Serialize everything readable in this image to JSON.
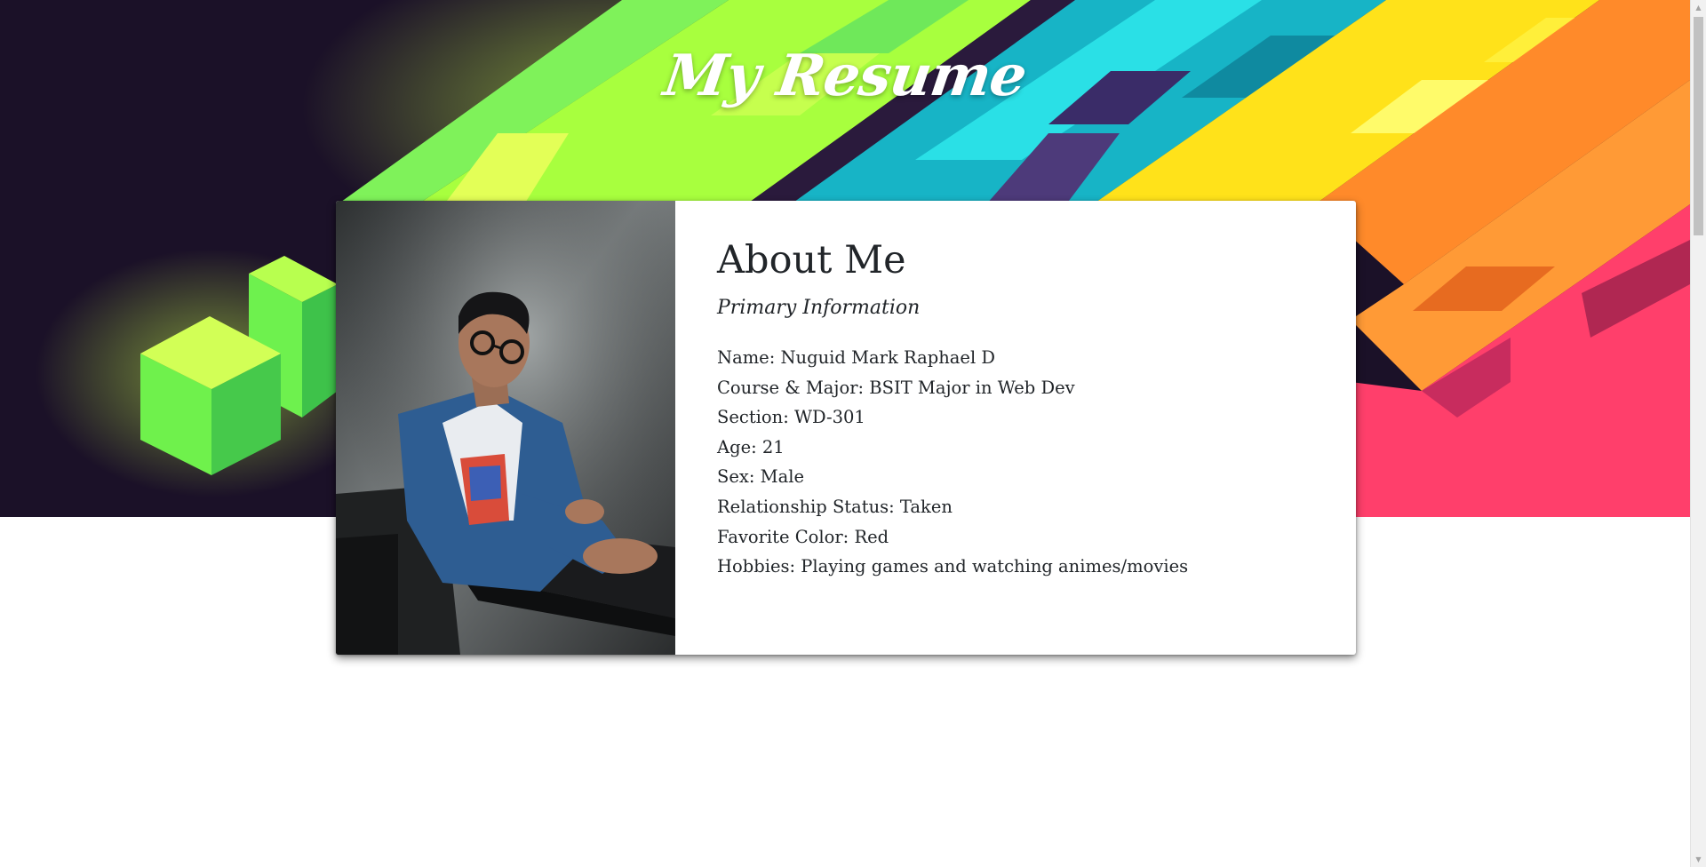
{
  "header": {
    "title": "My Resume"
  },
  "about": {
    "heading": "About Me",
    "subheading": "Primary Information",
    "photo_alt": "profile-photo",
    "items": [
      "Name: Nuguid Mark Raphael D",
      "Course & Major: BSIT Major in Web Dev",
      "Section: WD-301",
      "Age: 21",
      "Sex: Male",
      "Relationship Status: Taken",
      "Favorite Color: Red",
      "Hobbies: Playing games and watching animes/movies"
    ]
  },
  "colors": {
    "hero_bg": "#1b1128",
    "green": "#9cff3d",
    "cyan": "#1fb8c8",
    "yellow": "#ffe21a",
    "orange": "#ff8a2a",
    "pink": "#ff3f6b",
    "text": "#212529"
  },
  "icons": {
    "scroll_up": "scroll-up-arrow-icon",
    "scroll_down": "scroll-down-arrow-icon"
  }
}
